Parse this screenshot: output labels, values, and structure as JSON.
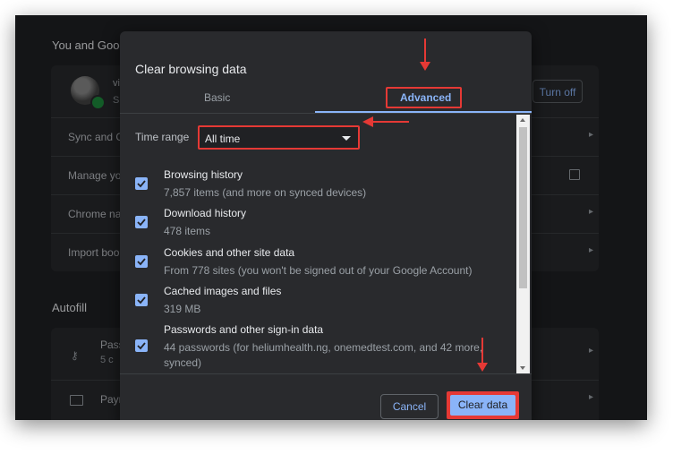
{
  "settings": {
    "you_and_google_heading": "You and Goog",
    "account_name": "vi",
    "account_sub": "S",
    "turn_off_button": "Turn off",
    "rows": [
      "Sync and G",
      "Manage yo",
      "Chrome na",
      "Import boo"
    ],
    "autofill_heading": "Autofill",
    "passwords_label": "Pass",
    "passwords_sub": "5 c",
    "payment_label": "Paym"
  },
  "dialog": {
    "title": "Clear browsing data",
    "tabs": {
      "basic": "Basic",
      "advanced": "Advanced",
      "active": "advanced"
    },
    "time_range": {
      "label": "Time range",
      "value": "All time"
    },
    "items": [
      {
        "title": "Browsing history",
        "sub": "7,857 items (and more on synced devices)",
        "checked": true
      },
      {
        "title": "Download history",
        "sub": "478 items",
        "checked": true
      },
      {
        "title": "Cookies and other site data",
        "sub": "From 778 sites (you won't be signed out of your Google Account)",
        "checked": true
      },
      {
        "title": "Cached images and files",
        "sub": "319 MB",
        "checked": true
      },
      {
        "title": "Passwords and other sign-in data",
        "sub": "44 passwords (for heliumhealth.ng, onemedtest.com, and 42 more, synced)",
        "checked": true
      }
    ],
    "cancel_button": "Cancel",
    "clear_button": "Clear data"
  },
  "icons": {
    "checkbox": "check-icon",
    "dropdown": "triangle-down-icon",
    "external": "open-in-new-icon",
    "key": "key-icon",
    "card": "credit-card-icon"
  },
  "colors": {
    "accent": "#8ab4f8",
    "annotation": "#e53935",
    "background": "#202124",
    "surface": "#292a2d"
  }
}
